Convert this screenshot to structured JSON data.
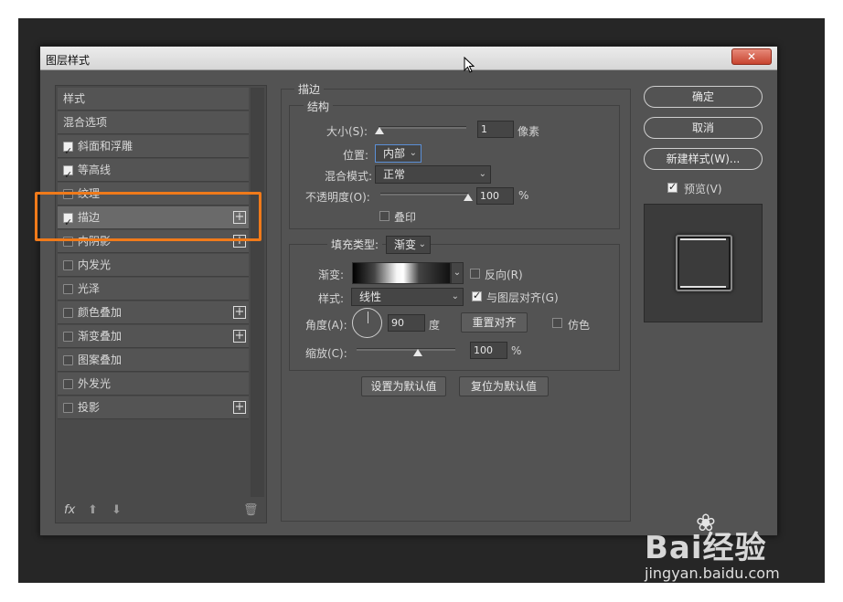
{
  "dialog": {
    "title": "图层样式",
    "close_label": "✕"
  },
  "left": {
    "items": [
      {
        "label": "样式",
        "checkbox": null,
        "plus": false
      },
      {
        "label": "混合选项",
        "checkbox": null,
        "plus": false
      },
      {
        "label": "斜面和浮雕",
        "checkbox": true,
        "plus": false
      },
      {
        "label": "等高线",
        "checkbox": true,
        "plus": false
      },
      {
        "label": "纹理",
        "checkbox": false,
        "plus": false
      },
      {
        "label": "描边",
        "checkbox": true,
        "plus": true,
        "selected": true
      },
      {
        "label": "内阴影",
        "checkbox": false,
        "plus": true
      },
      {
        "label": "内发光",
        "checkbox": false,
        "plus": false
      },
      {
        "label": "光泽",
        "checkbox": false,
        "plus": false
      },
      {
        "label": "颜色叠加",
        "checkbox": false,
        "plus": true
      },
      {
        "label": "渐变叠加",
        "checkbox": false,
        "plus": true
      },
      {
        "label": "图案叠加",
        "checkbox": false,
        "plus": false
      },
      {
        "label": "外发光",
        "checkbox": false,
        "plus": false
      },
      {
        "label": "投影",
        "checkbox": false,
        "plus": true
      }
    ],
    "footer": {
      "fx": "fx"
    }
  },
  "stroke": {
    "title": "描边",
    "structure_title": "结构",
    "size_label": "大小(S):",
    "size_value": "1",
    "size_unit": "像素",
    "position_label": "位置:",
    "position_value": "内部",
    "blend_label": "混合模式:",
    "blend_value": "正常",
    "opacity_label": "不透明度(O):",
    "opacity_value": "100",
    "opacity_unit": "%",
    "overprint_label": "叠印",
    "fill_type_label": "填充类型:",
    "fill_type_value": "渐变",
    "gradient_label": "渐变:",
    "reverse_label": "反向(R)",
    "style_label": "样式:",
    "style_value": "线性",
    "align_label": "与图层对齐(G)",
    "angle_label": "角度(A):",
    "angle_value": "90",
    "angle_unit": "度",
    "reset_align_label": "重置对齐",
    "dither_label": "仿色",
    "scale_label": "缩放(C):",
    "scale_value": "100",
    "scale_unit": "%",
    "set_default_label": "设置为默认值",
    "reset_default_label": "复位为默认值"
  },
  "right": {
    "ok_label": "确定",
    "cancel_label": "取消",
    "new_style_label": "新建样式(W)...",
    "preview_label": "预览(V)"
  },
  "watermark": {
    "brand": "Bai经验",
    "url": "jingyan.baidu.com"
  },
  "colors": {
    "highlight": "#f07a1a",
    "dialog_bg": "#535353"
  }
}
